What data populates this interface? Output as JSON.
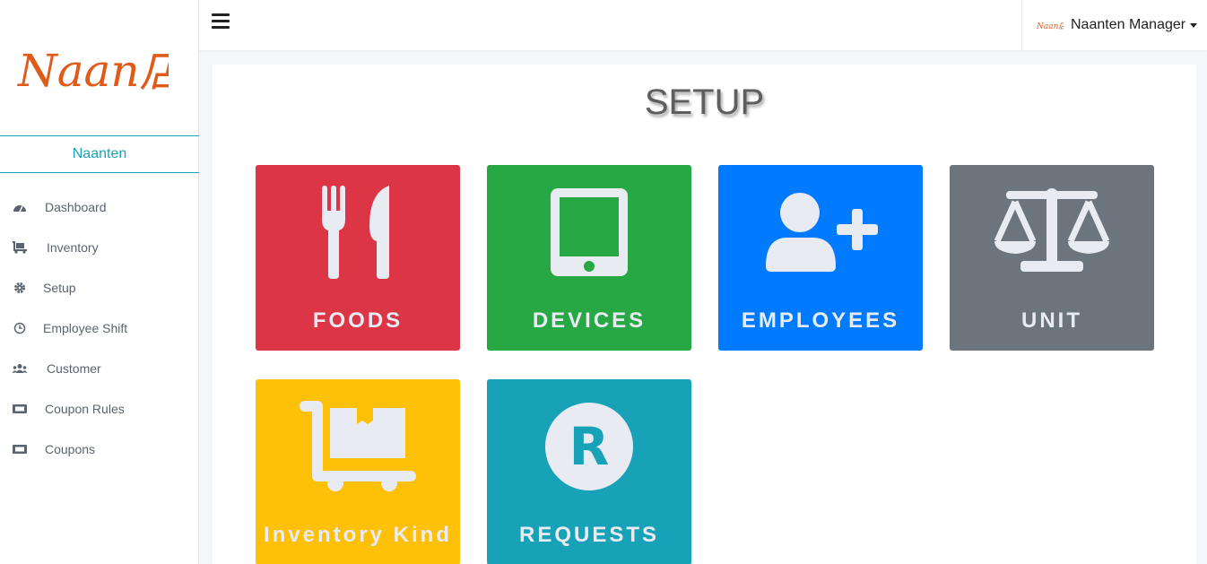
{
  "sidebar": {
    "logo_text": "Naan店",
    "brand": "Naanten",
    "items": [
      {
        "label": "Dashboard",
        "icon": "tachometer-icon"
      },
      {
        "label": "Inventory",
        "icon": "dolly-icon"
      },
      {
        "label": "Setup",
        "icon": "gear-icon"
      },
      {
        "label": "Employee Shift",
        "icon": "clock-icon"
      },
      {
        "label": "Customer",
        "icon": "users-icon"
      },
      {
        "label": "Coupon Rules",
        "icon": "ticket-icon"
      },
      {
        "label": "Coupons",
        "icon": "ticket-icon"
      }
    ]
  },
  "topbar": {
    "user_name": "Naanten Manager"
  },
  "main": {
    "title": "SETUP",
    "tiles": [
      {
        "label": "FOODS",
        "icon": "utensils-icon",
        "color": "#dc3545"
      },
      {
        "label": "DEVICES",
        "icon": "tablet-icon",
        "color": "#28a745"
      },
      {
        "label": "EMPLOYEES",
        "icon": "user-plus-icon",
        "color": "#007bff"
      },
      {
        "label": "UNIT",
        "icon": "balance-scale-icon",
        "color": "#6c757d"
      },
      {
        "label": "Inventory Kind",
        "icon": "dolly-box-icon",
        "color": "#ffc107"
      },
      {
        "label": "REQUESTS",
        "icon": "registered-icon",
        "color": "#17a2b8"
      }
    ]
  },
  "colors": {
    "brand_teal": "#17a2b8",
    "logo_orange": "#e05a1a",
    "icon_fill": "#e9ebf3"
  }
}
